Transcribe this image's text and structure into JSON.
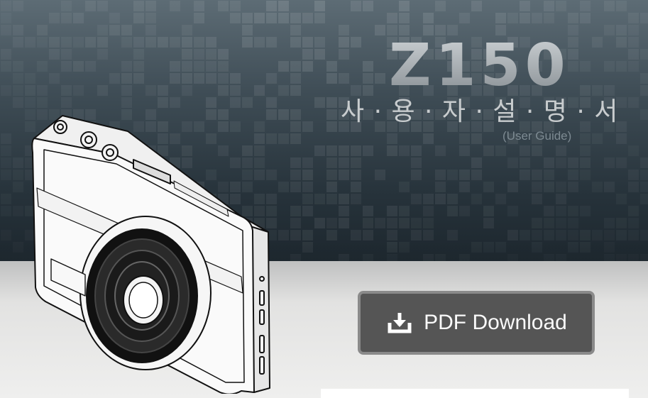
{
  "header": {
    "model": "Z150",
    "title_kr": "사 · 용 · 자 · 설 · 명 · 서",
    "title_en": "(User Guide)"
  },
  "download": {
    "label": "PDF Download",
    "icon": "download-icon"
  },
  "colors": {
    "hero_dark": "#1d272e",
    "hero_light": "#5d6c75",
    "button_bg": "#555555",
    "button_border": "#8a8a8a",
    "floor": "#ececeb"
  }
}
